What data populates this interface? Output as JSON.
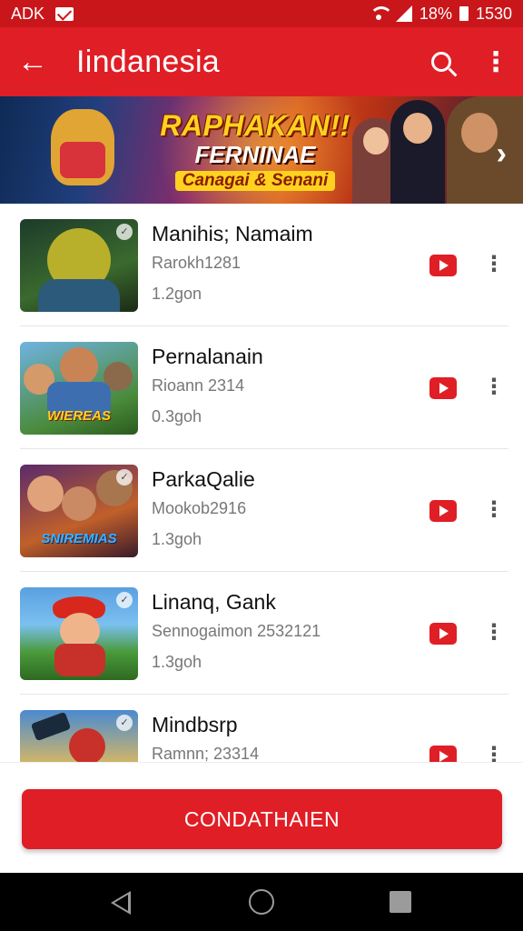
{
  "status_bar": {
    "left_text": "ADK",
    "battery_text": "18%",
    "time": "1530",
    "icons": [
      "mail-icon",
      "wifi-icon",
      "signal-icon",
      "battery-icon"
    ]
  },
  "app_bar": {
    "title": "Iindanesia",
    "back_icon": "←",
    "more_icon": "⋮"
  },
  "banner": {
    "line1": "RAPHAKAN!!",
    "line2": "FERNINAE",
    "line3": "Canagai & Senani",
    "next_icon": "›"
  },
  "games": [
    {
      "title": "Manihis; Namaim",
      "developer": "Rarokh1281",
      "size": "1.2gon"
    },
    {
      "title": "Pernalanain",
      "developer": "Rioann 2314",
      "size": "0.3goh",
      "thumb_label": "WIEREAS"
    },
    {
      "title": "ParkaQalie",
      "developer": "Mookob2916",
      "size": "1.3goh",
      "thumb_label": "SNIREMIAS"
    },
    {
      "title": "Linanq, Gank",
      "developer": "Sennogaimon 2532121",
      "size": "1.3goh"
    },
    {
      "title": "Mindbsrp",
      "developer": "Ramnn; 23314",
      "size": ""
    }
  ],
  "cta": {
    "label": "CONDATHAIEN"
  },
  "colors": {
    "primary": "#e01e25",
    "status_bar": "#c8161b",
    "banner_gold": "#ffd21f"
  }
}
